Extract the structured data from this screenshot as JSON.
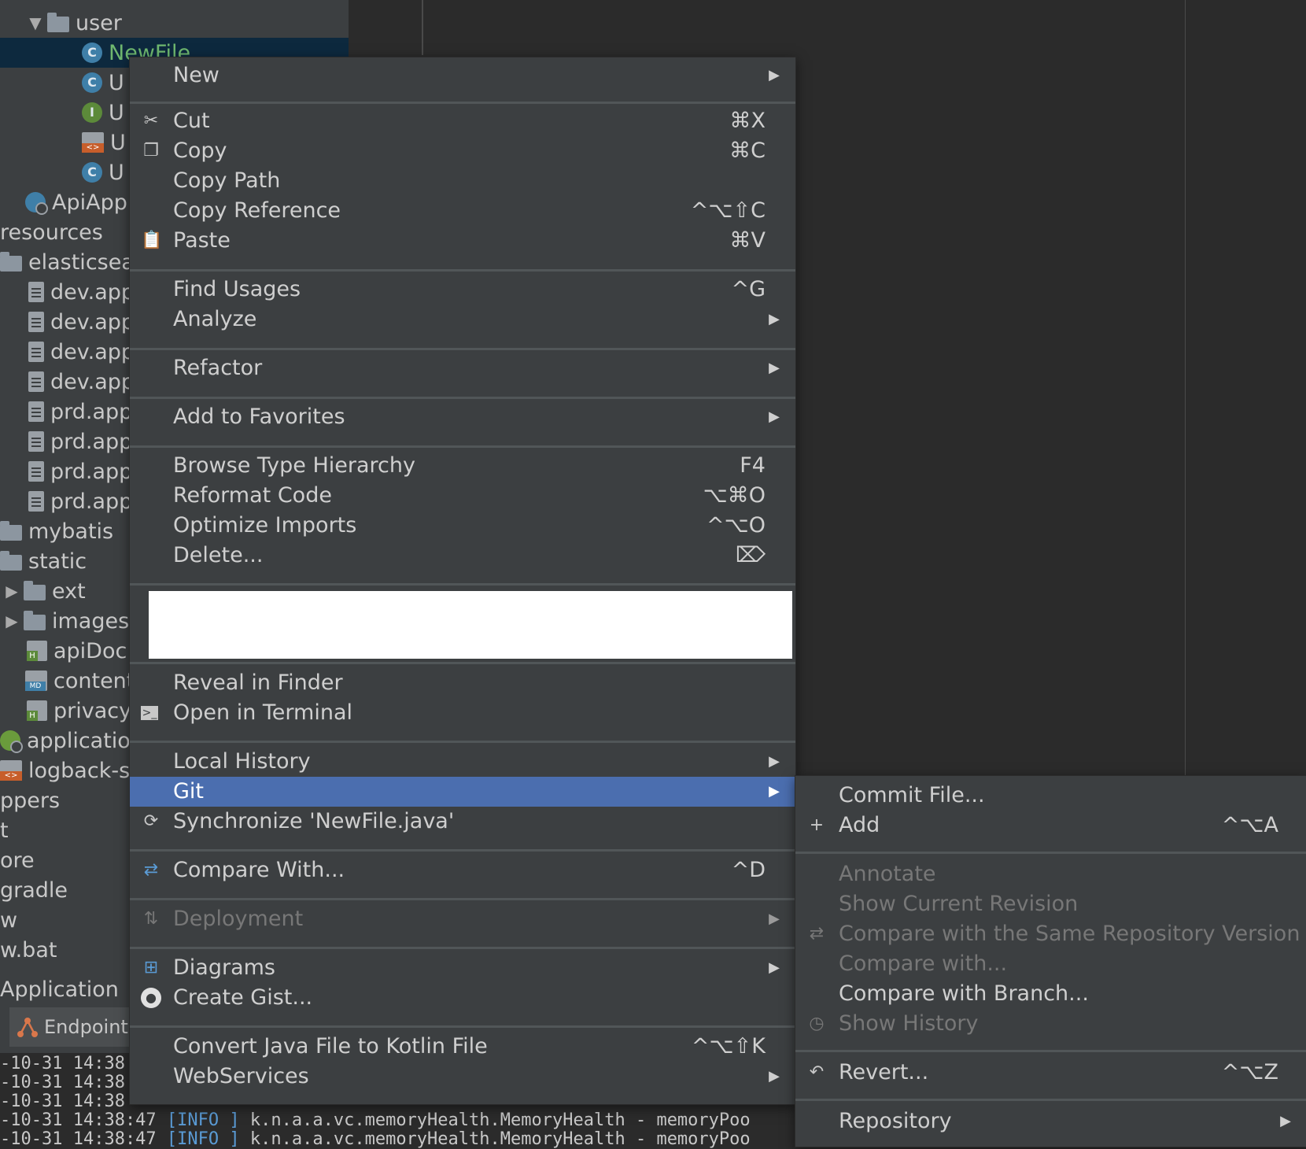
{
  "tree": {
    "items": [
      {
        "label": "user",
        "icon": "folder-icon",
        "arrow": "▼"
      },
      {
        "label": "NewFile",
        "icon": "class-icon",
        "badge": "C"
      },
      {
        "label": "U",
        "icon": "class-icon",
        "badge": "C"
      },
      {
        "label": "U",
        "icon": "interface-icon",
        "badge": "I"
      },
      {
        "label": "U",
        "icon": "xml-file-icon"
      },
      {
        "label": "U",
        "icon": "class-icon",
        "badge": "C"
      },
      {
        "label": "ApiAppl",
        "icon": "spring-app-icon"
      },
      {
        "label": "resources",
        "icon": ""
      },
      {
        "label": "elasticsear",
        "icon": "folder-icon"
      },
      {
        "label": "dev.app",
        "icon": "properties-file-icon"
      },
      {
        "label": "dev.app",
        "icon": "properties-file-icon"
      },
      {
        "label": "dev.app",
        "icon": "properties-file-icon"
      },
      {
        "label": "dev.app",
        "icon": "properties-file-icon"
      },
      {
        "label": "prd.app",
        "icon": "properties-file-icon"
      },
      {
        "label": "prd.app",
        "icon": "properties-file-icon"
      },
      {
        "label": "prd.app",
        "icon": "properties-file-icon"
      },
      {
        "label": "prd.app",
        "icon": "properties-file-icon"
      },
      {
        "label": "mybatis",
        "icon": "folder-icon"
      },
      {
        "label": "static",
        "icon": "folder-icon"
      },
      {
        "label": "ext",
        "icon": "folder-icon",
        "arrow": "▶"
      },
      {
        "label": "images",
        "icon": "folder-icon",
        "arrow": "▶"
      },
      {
        "label": "apiDoc.",
        "icon": "html-file-icon"
      },
      {
        "label": "content",
        "icon": "markdown-file-icon"
      },
      {
        "label": "privacy.",
        "icon": "html-file-icon"
      },
      {
        "label": "applicatior",
        "icon": "spring-config-icon"
      },
      {
        "label": "logback-sp",
        "icon": "xml-file-icon"
      },
      {
        "label": "ppers",
        "icon": ""
      },
      {
        "label": "t",
        "icon": ""
      },
      {
        "label": "ore",
        "icon": ""
      },
      {
        "label": "gradle",
        "icon": ""
      },
      {
        "label": "w",
        "icon": ""
      },
      {
        "label": "w.bat",
        "icon": ""
      }
    ]
  },
  "bottom": {
    "app_tab": "Application",
    "endpoints_tab": "Endpoints",
    "log_lines": [
      {
        "time": "-10-31 14:38",
        "level": "",
        "text": ""
      },
      {
        "time": "-10-31 14:38",
        "level": "",
        "text": ""
      },
      {
        "time": "-10-31 14:38",
        "level": "",
        "text": ""
      },
      {
        "time": "-10-31 14:38:47 ",
        "level": "[INFO ]",
        "text": " k.n.a.a.vc.memoryHealth.MemoryHealth - memoryPoo"
      },
      {
        "time": "-10-31 14:38:47 ",
        "level": "[INFO ]",
        "text": " k.n.a.a.vc.memoryHealth.MemoryHealth - memoryPoo"
      }
    ]
  },
  "menu": {
    "items": [
      {
        "label": "New",
        "submenu": "▶"
      },
      {
        "label": "Cut",
        "shortcut": "⌘X",
        "icon": "scissors-icon"
      },
      {
        "label": "Copy",
        "shortcut": "⌘C",
        "icon": "copy-icon"
      },
      {
        "label": "Copy Path"
      },
      {
        "label": "Copy Reference",
        "shortcut": "^⌥⇧C"
      },
      {
        "label": "Paste",
        "shortcut": "⌘V",
        "icon": "clipboard-icon"
      },
      {
        "label": "Find Usages",
        "shortcut": "^G"
      },
      {
        "label": "Analyze",
        "submenu": "▶"
      },
      {
        "label": "Refactor",
        "submenu": "▶"
      },
      {
        "label": "Add to Favorites",
        "submenu": "▶"
      },
      {
        "label": "Browse Type Hierarchy",
        "shortcut": "F4"
      },
      {
        "label": "Reformat Code",
        "shortcut": "⌥⌘O"
      },
      {
        "label": "Optimize Imports",
        "shortcut": "^⌥O"
      },
      {
        "label": "Delete...",
        "shortcut": "⌦"
      },
      {
        "label": "Reveal in Finder"
      },
      {
        "label": "Open in Terminal",
        "icon": "terminal-icon"
      },
      {
        "label": "Local History",
        "submenu": "▶"
      },
      {
        "label": "Git",
        "submenu": "▶"
      },
      {
        "label": "Synchronize 'NewFile.java'",
        "icon": "sync-icon"
      },
      {
        "label": "Compare With...",
        "shortcut": "^D",
        "icon": "compare-icon"
      },
      {
        "label": "Deployment",
        "submenu": "▶",
        "icon": "deployment-icon"
      },
      {
        "label": "Diagrams",
        "submenu": "▶",
        "icon": "diagram-icon"
      },
      {
        "label": "Create Gist...",
        "icon": "github-icon"
      },
      {
        "label": "Convert Java File to Kotlin File",
        "shortcut": "^⌥⇧K"
      },
      {
        "label": "WebServices",
        "submenu": "▶"
      }
    ]
  },
  "git_submenu": {
    "items": [
      {
        "label": "Commit File..."
      },
      {
        "label": "Add",
        "shortcut": "^⌥A",
        "icon": "plus-icon"
      },
      {
        "label": "Annotate"
      },
      {
        "label": "Show Current Revision"
      },
      {
        "label": "Compare with the Same Repository Version",
        "icon": "compare-icon"
      },
      {
        "label": "Compare with..."
      },
      {
        "label": "Compare with Branch..."
      },
      {
        "label": "Show History",
        "icon": "clock-icon"
      },
      {
        "label": "Revert...",
        "shortcut": "^⌥Z",
        "icon": "revert-icon"
      },
      {
        "label": "Repository",
        "submenu": "▶"
      }
    ]
  }
}
